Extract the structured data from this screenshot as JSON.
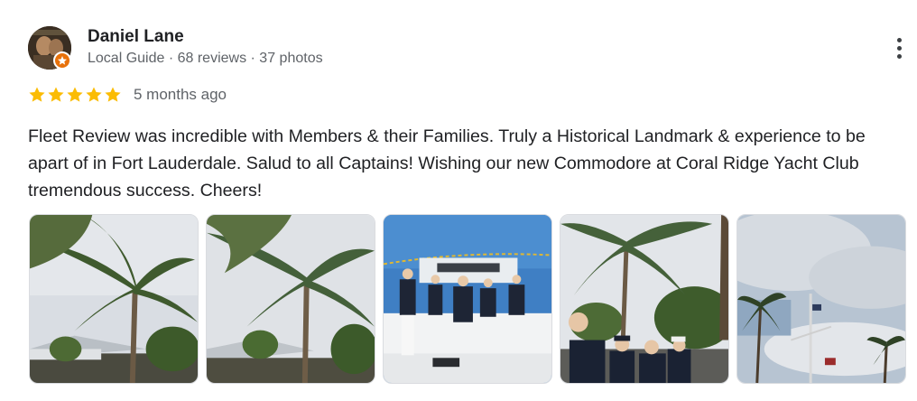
{
  "author": {
    "name": "Daniel Lane",
    "meta": "Local Guide · 68 reviews · 37 photos",
    "avatar_icon": "profile-photo",
    "badge_icon": "local-guide-star-icon",
    "badge_color": "#e8710a"
  },
  "rating": {
    "stars": 5,
    "max_stars": 5,
    "star_color": "#fbbc04",
    "date": "5 months ago"
  },
  "review": {
    "text": "Fleet Review was incredible with Members & their Families. Truly a Historical Landmark & experience to be apart of in Fort Lauderdale. Salud to all Captains! Wishing our new Commodore at Coral Ridge Yacht Club tremendous success. Cheers!"
  },
  "menu": {
    "icon": "more-vertical-icon"
  },
  "photos": [
    {
      "subject": "palm trees over clubhouse roof"
    },
    {
      "subject": "palm trees over clubhouse roof"
    },
    {
      "subject": "members standing on yacht deck"
    },
    {
      "subject": "officers in uniform under palm trees"
    },
    {
      "subject": "flagpole and palm trees against cloudy sky"
    }
  ]
}
